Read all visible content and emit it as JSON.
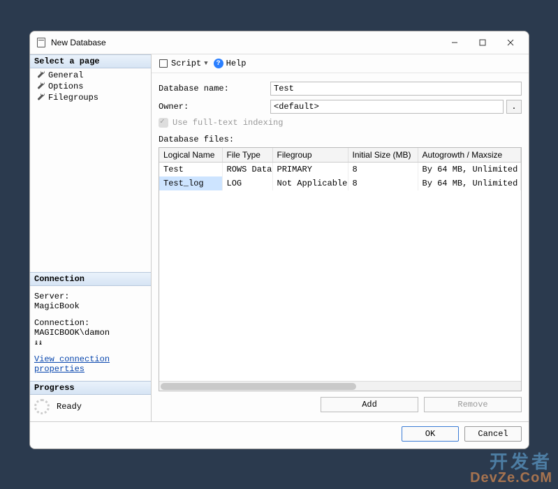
{
  "window": {
    "title": "New Database"
  },
  "sidebar": {
    "select_page_header": "Select a page",
    "pages": [
      {
        "label": "General"
      },
      {
        "label": "Options"
      },
      {
        "label": "Filegroups"
      }
    ],
    "connection_header": "Connection",
    "server_label": "Server:",
    "server_value": "MagicBook",
    "connection_label": "Connection:",
    "connection_value": "MAGICBOOK\\damon",
    "view_props_link": "View connection properties",
    "progress_header": "Progress",
    "progress_status": "Ready"
  },
  "toolbar": {
    "script_label": "Script",
    "help_label": "Help"
  },
  "form": {
    "db_name_label": "Database name:",
    "db_name_value": "Test",
    "owner_label": "Owner:",
    "owner_value": "<default>",
    "fulltext_label": "Use full-text indexing",
    "files_label": "Database files:"
  },
  "grid": {
    "headers": [
      "Logical Name",
      "File Type",
      "Filegroup",
      "Initial Size (MB)",
      "Autogrowth / Maxsize"
    ],
    "rows": [
      {
        "logical": "Test",
        "ftype": "ROWS Data",
        "fgroup": "PRIMARY",
        "size": "8",
        "growth": "By 64 MB, Unlimited"
      },
      {
        "logical": "Test_log",
        "ftype": "LOG",
        "fgroup": "Not Applicable",
        "size": "8",
        "growth": "By 64 MB, Unlimited"
      }
    ]
  },
  "buttons": {
    "add": "Add",
    "remove": "Remove",
    "ok": "OK",
    "cancel": "Cancel"
  },
  "watermark": {
    "line1": "开发者",
    "line2": "DevZe.CoM"
  }
}
